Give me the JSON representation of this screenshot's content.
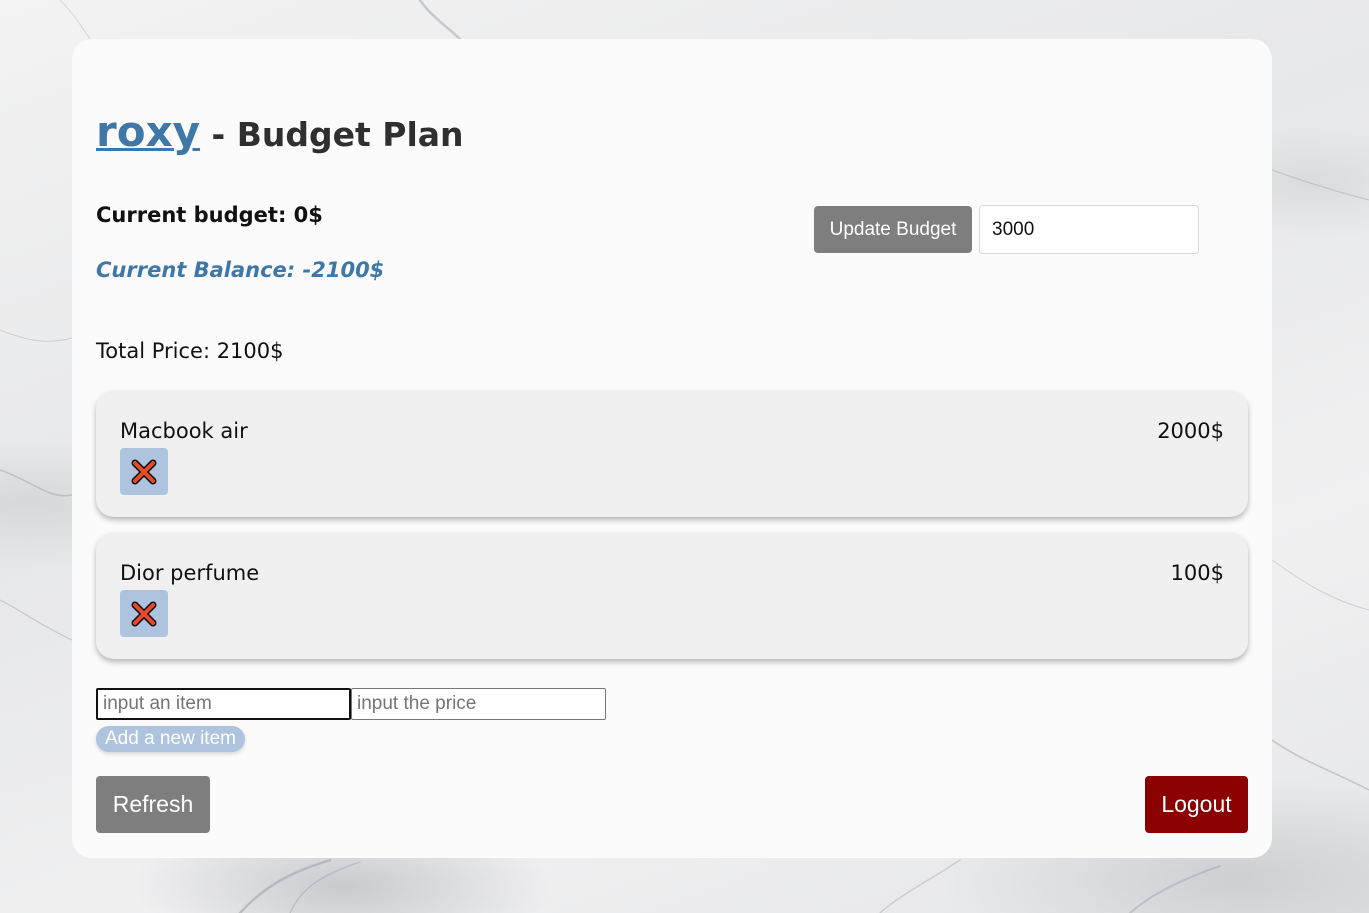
{
  "header": {
    "username": "roxy",
    "title_suffix": " - Budget Plan"
  },
  "summary": {
    "current_budget": "Current budget: 0$",
    "current_balance": "Current Balance: -2100$",
    "total_price": "Total Price: 2100$"
  },
  "budget_form": {
    "update_label": "Update Budget",
    "input_value": "3000"
  },
  "items": [
    {
      "name": "Macbook air",
      "price": "2000$"
    },
    {
      "name": "Dior perfume",
      "price": "100$"
    }
  ],
  "item_form": {
    "name_placeholder": "input an item",
    "price_placeholder": "input the price",
    "add_label": "Add a new item"
  },
  "footer": {
    "refresh_label": "Refresh",
    "logout_label": "Logout"
  },
  "icons": {
    "delete": "close-icon"
  },
  "colors": {
    "accent": "#3f78a8",
    "logout": "#8b0000",
    "neutral_button": "#7e7e7e",
    "delete_button": "#adc3de",
    "delete_icon": "#e8492b"
  }
}
